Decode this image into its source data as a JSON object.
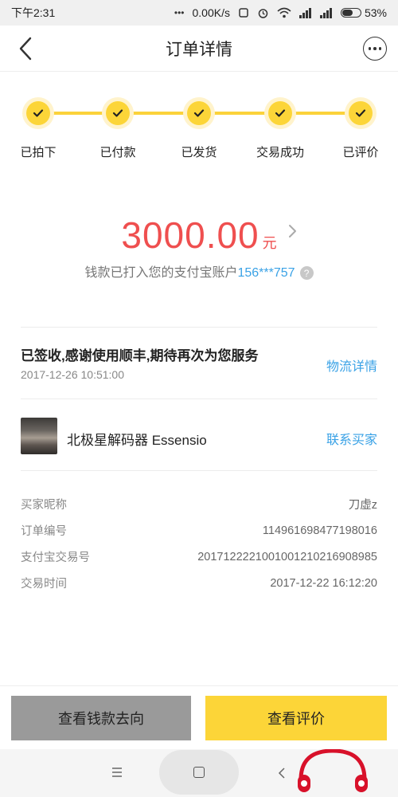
{
  "statusbar": {
    "time": "下午2:31",
    "network_speed": "0.00K/s",
    "battery": "53%",
    "battery_level": 0.53
  },
  "header": {
    "title": "订单详情",
    "back_icon": "chevron-left-icon",
    "more_icon": "more-icon"
  },
  "progress": {
    "accent": "#fcd538",
    "steps": [
      {
        "label": "已拍下"
      },
      {
        "label": "已付款"
      },
      {
        "label": "已发货"
      },
      {
        "label": "交易成功"
      },
      {
        "label": "已评价"
      }
    ]
  },
  "payment": {
    "amount": "3000.00",
    "unit": "元",
    "account_text": "钱款已打入您的支付宝账户",
    "account_number": "156***757",
    "help_icon": "?",
    "amount_color": "#ef4f4f",
    "link_color": "#3aa2e6"
  },
  "logistics": {
    "status": "已签收,感谢使用顺丰,期待再次为您服务",
    "time": "2017-12-26 10:51:00",
    "link": "物流详情"
  },
  "product": {
    "name": "北极星解码器 Essensio",
    "contact": "联系买家"
  },
  "info": [
    {
      "key": "买家昵称",
      "value": "刀虚z"
    },
    {
      "key": "订单编号",
      "value": "114961698477198016"
    },
    {
      "key": "支付宝交易号",
      "value": "2017122221001001210216908985"
    },
    {
      "key": "交易时间",
      "value": "2017-12-22 16:12:20"
    }
  ],
  "actions": {
    "money_flow": "查看钱款去向",
    "view_review": "查看评价"
  }
}
